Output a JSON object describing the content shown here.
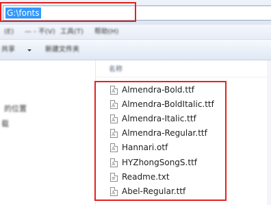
{
  "address_bar": {
    "path": "G:\\fonts"
  },
  "menu_bar": {
    "items": [
      "(E)",
      "— - 不(V)",
      "工具(T)",
      "帮助(H)"
    ]
  },
  "toolbar": {
    "left_label": "共享",
    "new_folder_label": "新建文件夹"
  },
  "nav_pane": {
    "items": [
      "的位置",
      "载"
    ]
  },
  "file_list": {
    "column_header": "名称",
    "files": [
      {
        "name": "Almendra-Bold.ttf",
        "icon": "font-file-icon"
      },
      {
        "name": "Almendra-BoldItalic.ttf",
        "icon": "font-file-icon"
      },
      {
        "name": "Almendra-Italic.ttf",
        "icon": "font-file-icon"
      },
      {
        "name": "Almendra-Regular.ttf",
        "icon": "font-file-icon"
      },
      {
        "name": "Hannari.otf",
        "icon": "font-file-icon"
      },
      {
        "name": "HYZhongSongS.ttf",
        "icon": "font-file-icon"
      },
      {
        "name": "Readme.txt",
        "icon": "text-file-icon"
      },
      {
        "name": "Abel-Regular.ttf",
        "icon": "font-file-icon"
      }
    ]
  },
  "colors": {
    "selection": "#3399ff",
    "highlight_box": "#e2221e"
  }
}
